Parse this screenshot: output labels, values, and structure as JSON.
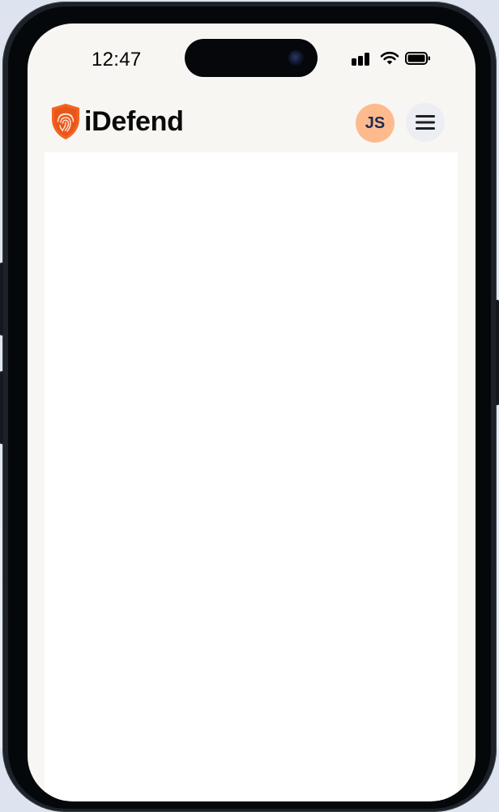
{
  "status_bar": {
    "time": "12:47",
    "icons": [
      "cellular-signal-icon",
      "wifi-icon",
      "battery-icon"
    ]
  },
  "header": {
    "logo_text": "iDefend",
    "logo_icon": "fingerprint-shield-icon",
    "avatar_initials": "JS",
    "menu_icon": "hamburger-menu-icon"
  },
  "colors": {
    "brand_orange": "#f26522",
    "avatar_bg": "#fdbb8d",
    "avatar_text": "#1f2a52",
    "screen_bg": "#f8f6f3",
    "content_bg": "#ffffff"
  }
}
